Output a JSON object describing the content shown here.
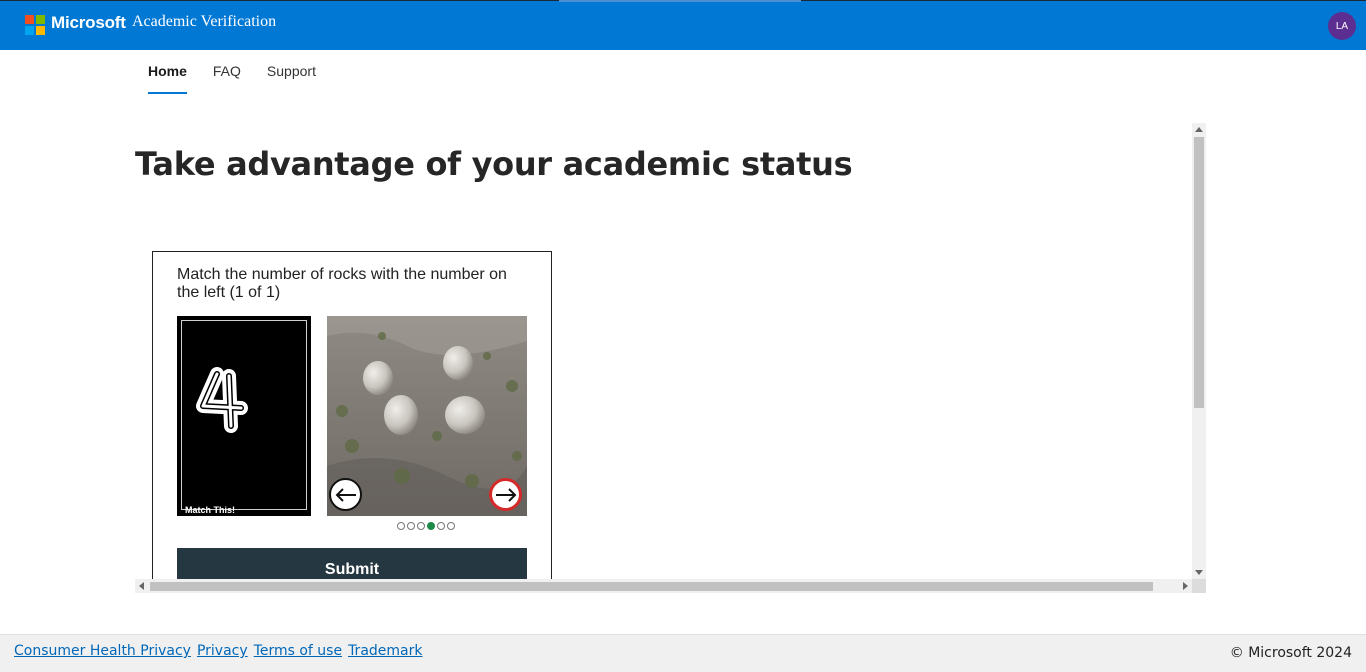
{
  "header": {
    "brand": "Microsoft",
    "app_title": "Academic Verification",
    "user_initials": "LA",
    "colors": {
      "bar": "#0078d4",
      "avatar": "#5c2e91"
    }
  },
  "nav": {
    "items": [
      {
        "label": "Home",
        "active": true
      },
      {
        "label": "FAQ",
        "active": false
      },
      {
        "label": "Support",
        "active": false
      }
    ]
  },
  "main": {
    "heading": "Take advantage of your academic status"
  },
  "challenge": {
    "prompt": "Match the number of rocks with the number on the left (1 of 1)",
    "target_number": "4",
    "match_label": "Match This!",
    "prev_icon": "arrow-left-icon",
    "next_icon": "arrow-right-icon",
    "pager": {
      "total": 6,
      "current": 4
    },
    "submit_label": "Submit"
  },
  "footer": {
    "links": [
      "Consumer Health Privacy",
      "Privacy",
      "Terms of use",
      "Trademark"
    ],
    "copyright": "© Microsoft 2024"
  }
}
